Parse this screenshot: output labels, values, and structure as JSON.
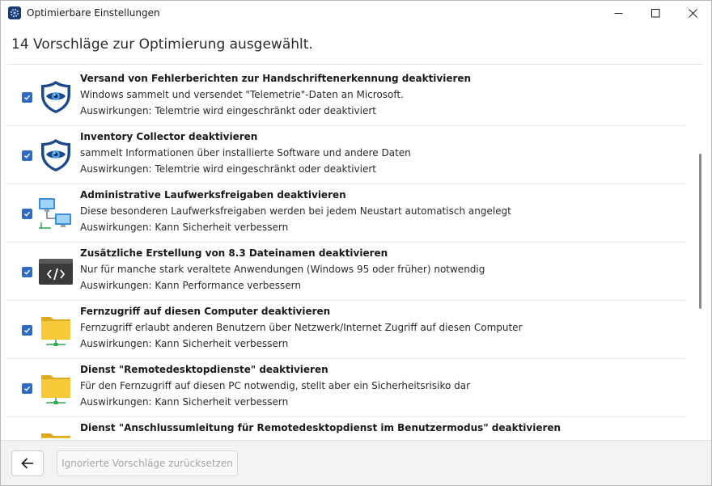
{
  "window": {
    "title": "Optimierbare Einstellungen",
    "app_icon": "gear-icon",
    "controls": [
      "minimize-icon",
      "maximize-icon",
      "close-icon"
    ]
  },
  "header": {
    "text": "14 Vorschläge zur Optimierung ausgewählt."
  },
  "items": [
    {
      "checked": true,
      "icon": "shield-eye-icon",
      "title": "Versand von Fehlerberichten zur Handschriftenerkennung deaktivieren",
      "description": "Windows sammelt und versendet \"Telemetrie\"-Daten an Microsoft.",
      "impact": "Auswirkungen: Telemtrie wird eingeschränkt oder deaktiviert"
    },
    {
      "checked": true,
      "icon": "shield-eye-icon",
      "title": "Inventory Collector deaktivieren",
      "description": "sammelt Informationen über installierte Software und andere Daten",
      "impact": "Auswirkungen: Telemtrie wird eingeschränkt oder deaktiviert"
    },
    {
      "checked": true,
      "icon": "network-computers-icon",
      "title": "Administrative Laufwerksfreigaben deaktivieren",
      "description": "Diese besonderen Laufwerksfreigaben werden bei jedem Neustart automatisch angelegt",
      "impact": "Auswirkungen: Kann Sicherheit verbessern"
    },
    {
      "checked": true,
      "icon": "code-window-icon",
      "title": "Zusätzliche Erstellung von 8.3 Dateinamen deaktivieren",
      "description": "Nur für manche stark veraltete Anwendungen (Windows 95 oder früher) notwendig",
      "impact": "Auswirkungen: Kann Performance verbessern"
    },
    {
      "checked": true,
      "icon": "network-folder-icon",
      "title": "Fernzugriff auf diesen Computer deaktivieren",
      "description": "Fernzugriff erlaubt anderen Benutzern über Netzwerk/Internet Zugriff auf diesen Computer",
      "impact": "Auswirkungen: Kann Sicherheit verbessern"
    },
    {
      "checked": true,
      "icon": "network-folder-icon",
      "title": "Dienst \"Remotedesktopdienste\" deaktivieren",
      "description": "Für den Fernzugriff auf diesen PC notwendig, stellt aber ein Sicherheitsrisiko dar",
      "impact": "Auswirkungen: Kann Sicherheit verbessern"
    },
    {
      "checked": true,
      "icon": "network-folder-icon",
      "title": "Dienst \"Anschlussumleitung für Remotedesktopdienst im Benutzermodus\" deaktivieren",
      "description": "",
      "impact": ""
    }
  ],
  "footer": {
    "back_icon": "arrow-left-icon",
    "reset_label": "Ignorierte Vorschläge zurücksetzen"
  },
  "colors": {
    "accent": "#2d6bc4",
    "shield": "#1a4a8c",
    "folder": "#f2c12e"
  }
}
